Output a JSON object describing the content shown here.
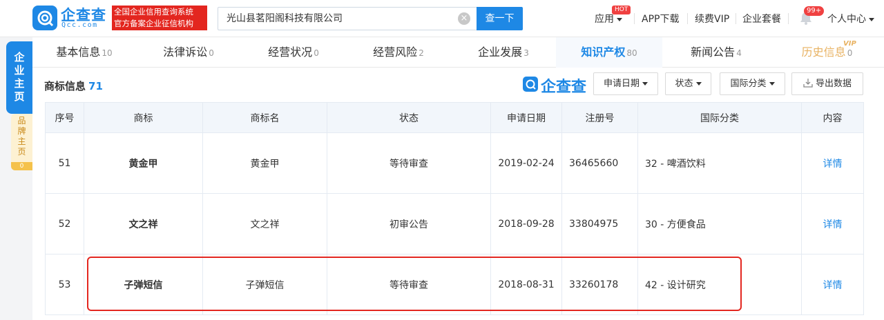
{
  "header": {
    "logo_text": "企查查",
    "logo_sub": "Qcc.com",
    "badge_line1": "全国企业信用查询系统",
    "badge_line2": "官方备案企业征信机构",
    "search_value": "光山县茗阳阁科技有限公司",
    "search_button": "查一下",
    "nav": {
      "apps": "应用",
      "hot": "HOT",
      "app_download": "APP下载",
      "vip": "续费VIP",
      "package": "企业套餐",
      "notice_count": "99+",
      "personal": "个人中心"
    }
  },
  "side": {
    "main_tab": [
      "企",
      "业",
      "主",
      "页"
    ],
    "brand_tab": [
      "品",
      "牌",
      "主",
      "页"
    ],
    "brand_count": "0"
  },
  "tabs": [
    {
      "label": "基本信息",
      "count": "10"
    },
    {
      "label": "法律诉讼",
      "count": "0"
    },
    {
      "label": "经营状况",
      "count": "0"
    },
    {
      "label": "经营风险",
      "count": "2"
    },
    {
      "label": "企业发展",
      "count": "3"
    },
    {
      "label": "知识产权",
      "count": "80"
    },
    {
      "label": "新闻公告",
      "count": "4"
    },
    {
      "label": "历史信息",
      "count": "0"
    }
  ],
  "vip_mark": "VIP",
  "section": {
    "title": "商标信息",
    "count": "71",
    "brand_logo": "企查查",
    "filters": [
      "申请日期",
      "状态",
      "国际分类"
    ],
    "export": "导出数据"
  },
  "table": {
    "headers": [
      "序号",
      "商标",
      "商标名",
      "状态",
      "申请日期",
      "注册号",
      "国际分类",
      "内容"
    ],
    "rows": [
      {
        "no": "51",
        "mark": "黄金甲",
        "name": "黄金甲",
        "status": "等待审查",
        "date": "2019-02-24",
        "reg": "36465660",
        "class": "32 - 啤酒饮料",
        "detail": "详情"
      },
      {
        "no": "52",
        "mark": "文之祥",
        "name": "文之祥",
        "status": "初审公告",
        "date": "2018-09-28",
        "reg": "33804975",
        "class": "30 - 方便食品",
        "detail": "详情"
      },
      {
        "no": "53",
        "mark": "子弹短信",
        "name": "子弹短信",
        "status": "等待审查",
        "date": "2018-08-31",
        "reg": "33260178",
        "class": "42 - 设计研究",
        "detail": "详情"
      }
    ]
  },
  "colors": {
    "primary": "#1e88e5",
    "badge_red": "#e3261f",
    "history_gold": "#e8b262",
    "header_bg": "#f2f6fb"
  }
}
